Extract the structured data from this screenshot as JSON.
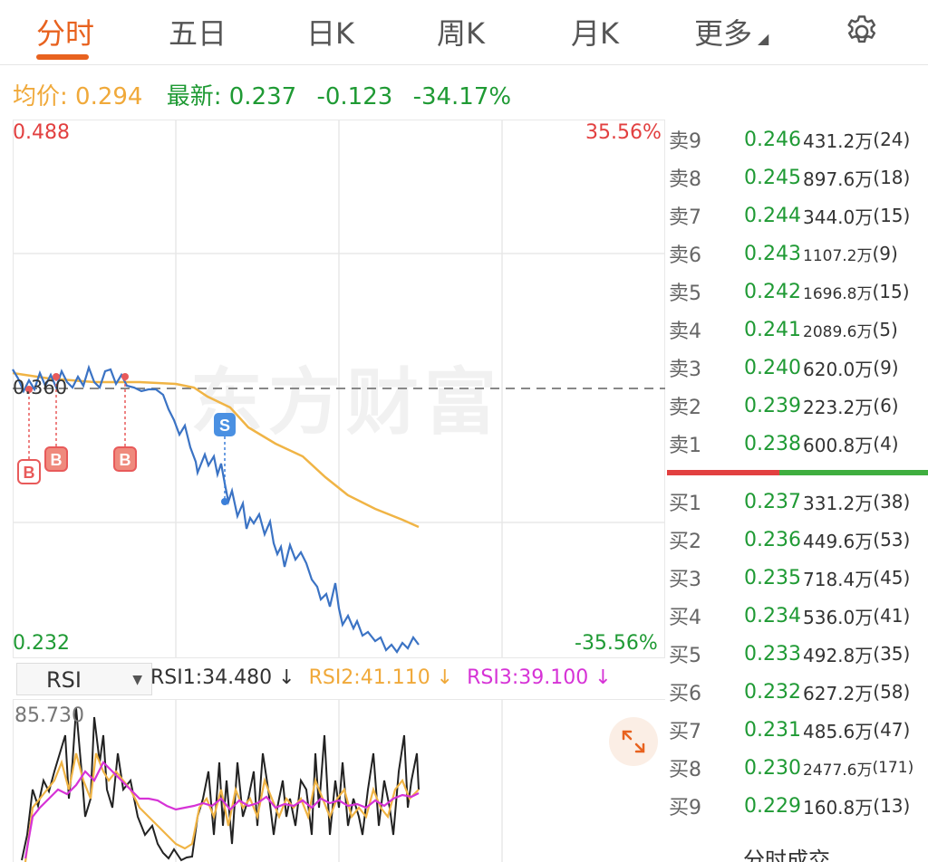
{
  "tabs": [
    {
      "label": "分时",
      "active": true
    },
    {
      "label": "五日"
    },
    {
      "label": "日K"
    },
    {
      "label": "周K"
    },
    {
      "label": "月K"
    },
    {
      "label": "更多"
    }
  ],
  "info": {
    "avg_label": "均价:",
    "avg_value": "0.294",
    "latest_label": "最新:",
    "latest_value": "0.237",
    "change": "-0.123",
    "change_pct": "-34.17%"
  },
  "chart": {
    "price_high": "0.488",
    "price_low": "0.232",
    "pct_high": "35.56%",
    "pct_low": "-35.56%",
    "prev_close": "0.360",
    "watermark": "东方财富",
    "markers": [
      "B",
      "B",
      "B",
      "S"
    ],
    "colors": {
      "price_line": "#3b73c4",
      "avg_line": "#f0b445",
      "up": "#e24040",
      "down": "#1f9a34"
    }
  },
  "orderbook": {
    "asks": [
      {
        "name": "卖9",
        "price": "0.246",
        "vol": "431.2万",
        "count": "(24)"
      },
      {
        "name": "卖8",
        "price": "0.245",
        "vol": "897.6万",
        "count": "(18)"
      },
      {
        "name": "卖7",
        "price": "0.244",
        "vol": "344.0万",
        "count": "(15)"
      },
      {
        "name": "卖6",
        "price": "0.243",
        "vol": "1107.2万",
        "count": "(9)"
      },
      {
        "name": "卖5",
        "price": "0.242",
        "vol": "1696.8万",
        "count": "(15)"
      },
      {
        "name": "卖4",
        "price": "0.241",
        "vol": "2089.6万",
        "count": "(5)"
      },
      {
        "name": "卖3",
        "price": "0.240",
        "vol": "620.0万",
        "count": "(9)"
      },
      {
        "name": "卖2",
        "price": "0.239",
        "vol": "223.2万",
        "count": "(6)"
      },
      {
        "name": "卖1",
        "price": "0.238",
        "vol": "600.8万",
        "count": "(4)"
      }
    ],
    "bids": [
      {
        "name": "买1",
        "price": "0.237",
        "vol": "331.2万",
        "count": "(38)"
      },
      {
        "name": "买2",
        "price": "0.236",
        "vol": "449.6万",
        "count": "(53)"
      },
      {
        "name": "买3",
        "price": "0.235",
        "vol": "718.4万",
        "count": "(45)"
      },
      {
        "name": "买4",
        "price": "0.234",
        "vol": "536.0万",
        "count": "(41)"
      },
      {
        "name": "买5",
        "price": "0.233",
        "vol": "492.8万",
        "count": "(35)"
      },
      {
        "name": "买6",
        "price": "0.232",
        "vol": "627.2万",
        "count": "(58)"
      },
      {
        "name": "买7",
        "price": "0.231",
        "vol": "485.6万",
        "count": "(47)"
      },
      {
        "name": "买8",
        "price": "0.230",
        "vol": "2477.6万",
        "count": "(171)"
      },
      {
        "name": "买9",
        "price": "0.229",
        "vol": "160.8万",
        "count": "(13)"
      }
    ],
    "footer": "分时成交"
  },
  "indicator": {
    "selected": "RSI",
    "rsi1": "RSI1:34.480 ↓",
    "rsi2": "RSI2:41.110 ↓",
    "rsi3": "RSI3:39.100 ↓",
    "top_value": "85.730",
    "colors": {
      "rsi1": "#222222",
      "rsi2": "#f0b445",
      "rsi3": "#d633d6"
    }
  }
}
